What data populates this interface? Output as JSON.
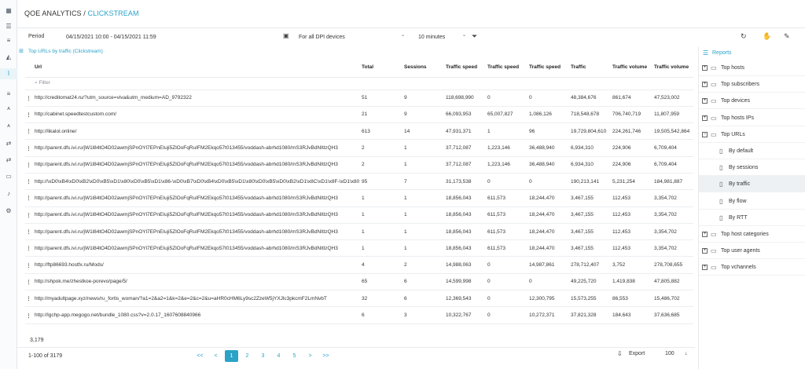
{
  "header": {
    "title_main": "QOE ANALYTICS / ",
    "title_accent": "CLICKSTREAM"
  },
  "toolbar": {
    "period_label": "Period",
    "period_value": "04/15/2021 10:00 - 04/15/2021 11:59",
    "devices_value": "For all DPI devices",
    "interval_value": "10 minutes"
  },
  "panel": {
    "title": "Top URLs by traffic (Clickstream)"
  },
  "table": {
    "headers": [
      "Url",
      "Total",
      "Sessions",
      "Traffic speed",
      "Traffic speed",
      "Traffic speed",
      "Traffic",
      "Traffic volume",
      "Traffic volume"
    ],
    "filter_placeholder": "Filter",
    "rows": [
      [
        "http://creditomat24.ru/?utm_source=viva&utm_medium=AD_9792322",
        "51",
        "9",
        "118,698,990",
        "0",
        "0",
        "48,384,676",
        "861,674",
        "47,523,002"
      ],
      [
        "http://cabinet.speedtestcustom.com/",
        "21",
        "9",
        "66,093,953",
        "65,007,827",
        "1,086,126",
        "718,548,678",
        "706,740,719",
        "11,807,959"
      ],
      [
        "http://likalol.online/",
        "613",
        "14",
        "47,931,371",
        "1",
        "96",
        "19,729,804,610",
        "224,261,746",
        "19,505,542,864"
      ],
      [
        "http://parent.dfs.ivi.ru/jW1l84tO4D02awmjSPnOYl7EPnEIuji5ZlOoFqRuIFM2Ekqo57t013455/voddash-abrhd1080/mS3RJvBdNItlzQH3",
        "2",
        "1",
        "37,712,087",
        "1,223,146",
        "36,488,940",
        "6,934,310",
        "224,906",
        "6,709,404"
      ],
      [
        "http://parent.dfs.ivi.ru/jW1l84tO4D02awmjSPnOYl7EPnEIuji5ZlOoFqRuIFM2Ekqo57t013455/voddash-abrhd1080/mS3RJvBdNItlzQH3",
        "2",
        "1",
        "37,712,087",
        "1,223,146",
        "36,488,940",
        "6,934,310",
        "224,906",
        "6,709,404"
      ],
      [
        "http://\\xD0\\xB4\\xD0\\xB2\\xD0\\xB5\\xD1\\x80\\xD0\\xB5\\xD1\\x86-\\xD0\\xB7\\xD0\\xB4\\xD0\\xB5\\xD1\\x80\\xD0\\xB5\\xD0\\xB2\\xD1\\x8C\\xD1\\x8F-\\xD1\\x80\\xD0\\xB0\\",
        "95",
        "7",
        "31,173,538",
        "0",
        "0",
        "190,213,141",
        "5,231,254",
        "184,981,887"
      ],
      [
        "http://parent.dfs.ivi.ru/jW1l84tO4D02awmjSPnOYl7EPnEIuji5ZlOoFqRuIFM2Ekqo57t013455/voddash-abrhd1080/mS3RJvBdNItlzQH3",
        "1",
        "1",
        "18,856,043",
        "611,573",
        "18,244,470",
        "3,467,155",
        "112,453",
        "3,354,702"
      ],
      [
        "http://parent.dfs.ivi.ru/jW1l84tO4D02awmjSPnOYl7EPnEIuji5ZlOoFqRuIFM2Ekqo57t013455/voddash-abrhd1080/mS3RJvBdNItlzQH3",
        "1",
        "1",
        "18,856,043",
        "611,573",
        "18,244,470",
        "3,467,155",
        "112,453",
        "3,354,702"
      ],
      [
        "http://parent.dfs.ivi.ru/jW1l84tO4D02awmjSPnOYl7EPnEIuji5ZlOoFqRuIFM2Ekqo57t013455/voddash-abrhd1080/mS3RJvBdNItlzQH3",
        "1",
        "1",
        "18,856,043",
        "611,573",
        "18,244,470",
        "3,467,155",
        "112,453",
        "3,354,702"
      ],
      [
        "http://parent.dfs.ivi.ru/jW1l84tO4D02awmjSPnOYl7EPnEIuji5ZlOoFqRuIFM2Ekqo57t013455/voddash-abrhd1080/mS3RJvBdNItlzQH3",
        "1",
        "1",
        "18,856,043",
        "611,573",
        "18,244,470",
        "3,467,155",
        "112,453",
        "3,354,702"
      ],
      [
        "http://ftp86693.hostfx.ru/Mods/",
        "4",
        "2",
        "14,988,063",
        "0",
        "14,987,861",
        "278,712,407",
        "3,752",
        "278,708,655"
      ],
      [
        "http://shpok.me/zhestkoe-porevo/page/5/",
        "65",
        "6",
        "14,599,998",
        "0",
        "0",
        "49,225,720",
        "1,419,838",
        "47,805,882"
      ],
      [
        "http://myadultpage.xyz/news/ru_fortis_woman/?a1=2&a2=1&k=2&e=2&c=2&u=aHR0cHM6Ly9sc2ZzeW5jYXJlc3pkcmF2LmNvbT",
        "32",
        "6",
        "12,369,543",
        "0",
        "12,300,795",
        "15,573,255",
        "86,553",
        "15,486,702"
      ],
      [
        "http://lgchp-app.megogo.net/bundle_1080.css?v=2.0.17_1607608840966",
        "6",
        "3",
        "10,322,767",
        "0",
        "10,272,371",
        "37,821,328",
        "184,643",
        "37,636,685"
      ]
    ]
  },
  "summary": {
    "total": "3,179",
    "range": "1-100 of 3179"
  },
  "pager": {
    "first": "<<",
    "prev": "<",
    "pages": [
      "1",
      "2",
      "3",
      "4",
      "5"
    ],
    "next": ">",
    "last": ">>"
  },
  "export_label": "Export",
  "page_size": "100",
  "reports": {
    "title": "Reports",
    "items": [
      {
        "label": "Top hosts",
        "level": 0,
        "expander": "+"
      },
      {
        "label": "Top subscribers",
        "level": 0,
        "expander": "+"
      },
      {
        "label": "Top devices",
        "level": 0,
        "expander": "+"
      },
      {
        "label": "Top hosts IPs",
        "level": 0,
        "expander": "+"
      },
      {
        "label": "Top URLs",
        "level": 0,
        "expander": "−"
      },
      {
        "label": "By default",
        "level": 1
      },
      {
        "label": "By sessions",
        "level": 1
      },
      {
        "label": "By traffic",
        "level": 1,
        "active": true
      },
      {
        "label": "By flow",
        "level": 1
      },
      {
        "label": "By RTT",
        "level": 1
      },
      {
        "label": "Top host categories",
        "level": 0,
        "expander": "+"
      },
      {
        "label": "Top user agents",
        "level": 0,
        "expander": "+"
      },
      {
        "label": "Top vchannels",
        "level": 0,
        "expander": "+"
      }
    ]
  },
  "icons": {
    "rail": [
      "grid-icon",
      "list-icon",
      "chart-icon",
      "graph-icon",
      "list-icon",
      "ab-icon",
      "ab-icon",
      "transfer-icon",
      "transfer-icon",
      "monitor-icon",
      "bell-icon",
      "gear-icon"
    ],
    "accent": "#2aa3c7"
  }
}
